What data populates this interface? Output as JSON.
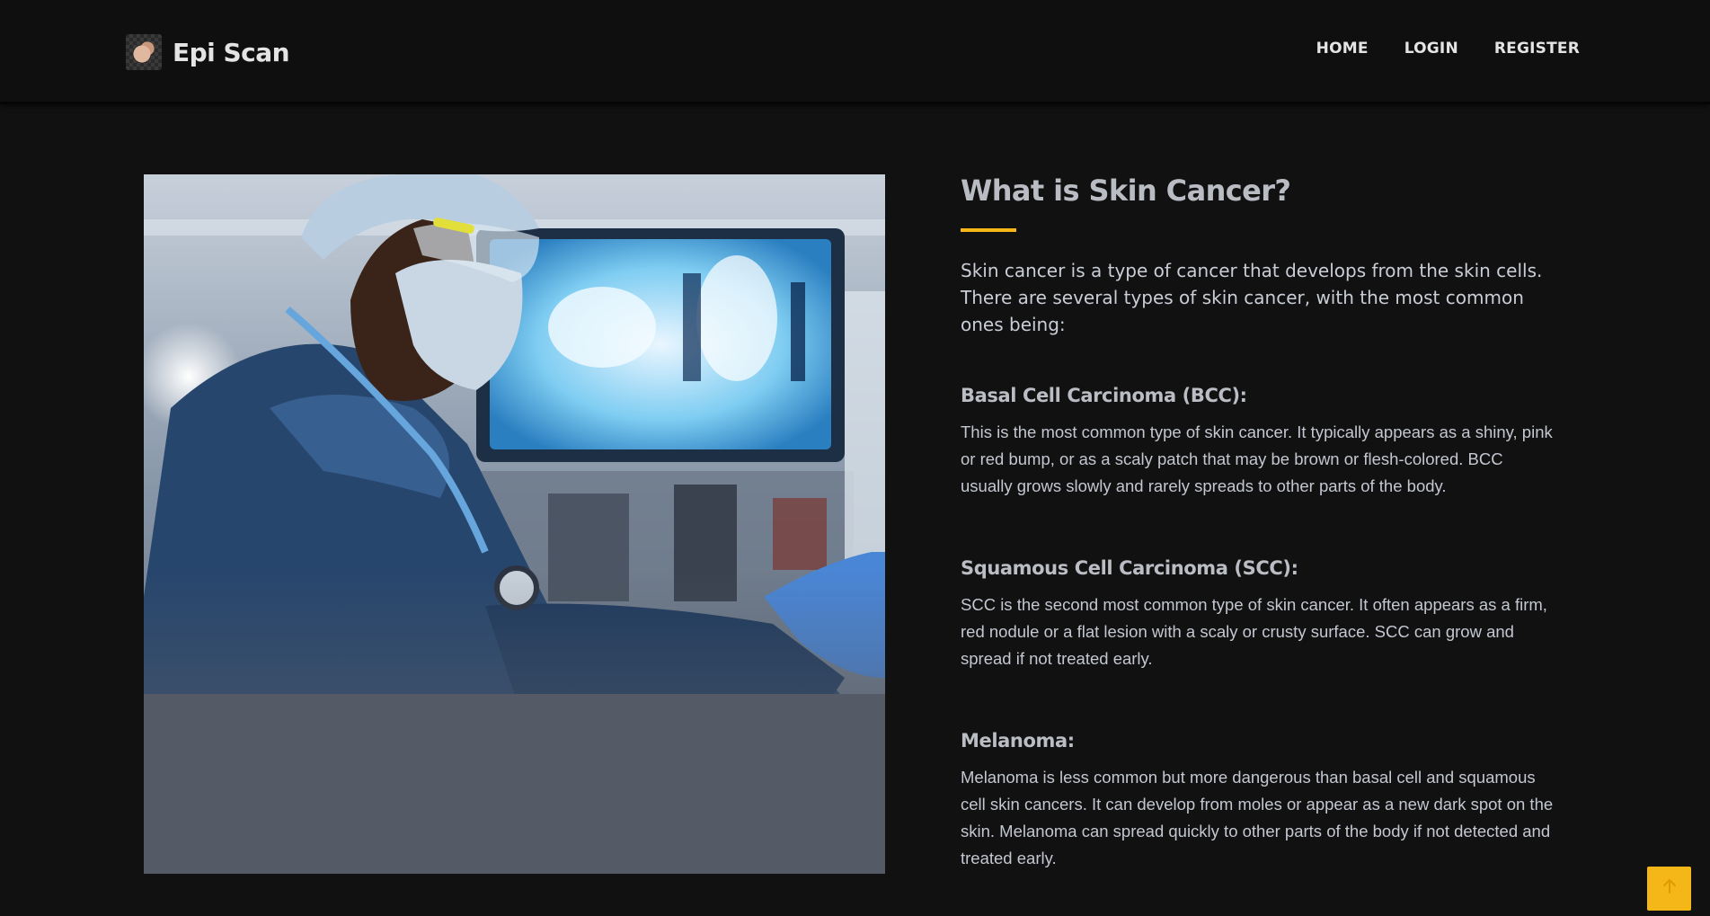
{
  "header": {
    "brand": "Epi Scan",
    "nav": [
      {
        "label": "HOME"
      },
      {
        "label": "LOGIN"
      },
      {
        "label": "REGISTER"
      }
    ]
  },
  "main": {
    "title": "What is Skin Cancer?",
    "intro": "Skin cancer is a type of cancer that develops from the skin cells. There are several types of skin cancer, with the most common ones being:",
    "sections": [
      {
        "heading": "Basal Cell Carcinoma (BCC):",
        "body": "This is the most common type of skin cancer. It typically appears as a shiny, pink or red bump, or as a scaly patch that may be brown or flesh-colored. BCC usually grows slowly and rarely spreads to other parts of the body."
      },
      {
        "heading": "Squamous Cell Carcinoma (SCC):",
        "body": "SCC is the second most common type of skin cancer. It often appears as a firm, red nodule or a flat lesion with a scaly or crusty surface. SCC can grow and spread if not treated early."
      },
      {
        "heading": "Melanoma:",
        "body": "Melanoma is less common but more dangerous than basal cell and squamous cell skin cancers. It can develop from moles or appear as a new dark spot on the skin. Melanoma can spread quickly to other parts of the body if not detected and treated early."
      }
    ]
  },
  "colors": {
    "background": "#111112",
    "accent": "#f5b617",
    "heading": "#b9bcc3",
    "text": "#c9cdd6"
  },
  "icons": {
    "logo": "epi-scan-logo",
    "scroll_top": "arrow-up-icon"
  }
}
